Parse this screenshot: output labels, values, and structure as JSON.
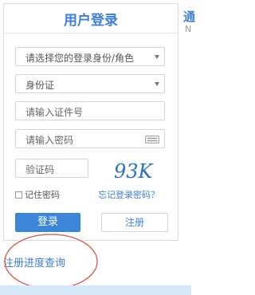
{
  "login": {
    "title": "用户登录",
    "identity_select": "请选择您的登录身份/角色",
    "id_type_select": "身份证",
    "id_number_placeholder": "请输入证件号",
    "password_placeholder": "请输入密码",
    "captcha_placeholder": "验证码",
    "captcha_text": "93K",
    "remember_label": "记住密码",
    "forgot_label": "忘记登录密码？",
    "login_button": "登录",
    "register_button": "注册"
  },
  "progress_link": "注册进度查询",
  "right_partial": {
    "title_char": "通",
    "sub_char": "N"
  },
  "colors": {
    "accent": "#3d7fd6",
    "annotation": "#d9534f"
  }
}
